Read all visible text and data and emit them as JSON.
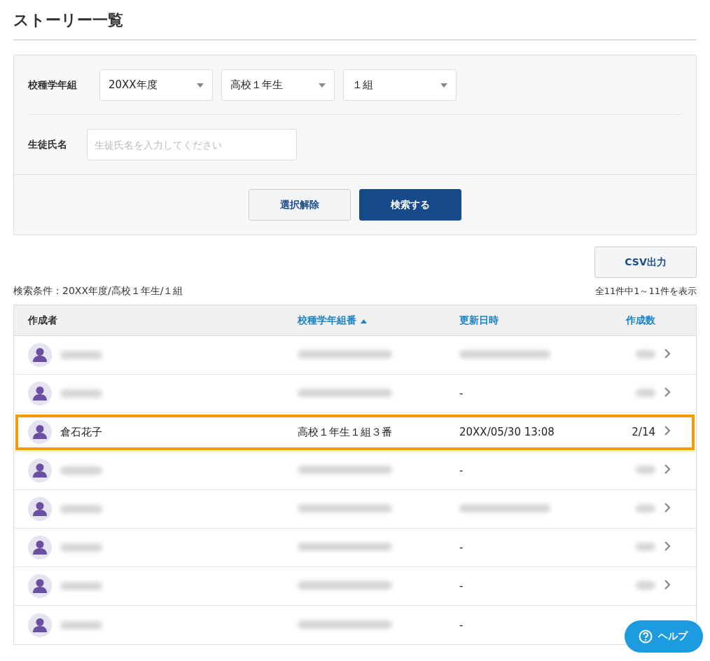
{
  "title": "ストーリー一覧",
  "filter": {
    "grade_label": "校種学年組",
    "selects": [
      {
        "value": "20XX年度"
      },
      {
        "value": "高校１年生"
      },
      {
        "value": "１組"
      }
    ],
    "name_label": "生徒氏名",
    "name_placeholder": "生徒氏名を入力してください",
    "buttons": [
      {
        "label": "選択解除",
        "kind": "secondary"
      },
      {
        "label": "検索する",
        "kind": "primary"
      }
    ]
  },
  "csv_button": "CSV出力",
  "condition": "検索条件：20XX年度/高校１年生/１組",
  "result_count": "全11件中1～11件を表示",
  "table": {
    "columns": [
      {
        "label": "作成者",
        "sortable": false,
        "sorted": false
      },
      {
        "label": "校種学年組番",
        "sortable": true,
        "sorted": true
      },
      {
        "label": "更新日時",
        "sortable": true,
        "sorted": false
      },
      {
        "label": "作成数",
        "sortable": true,
        "sorted": false
      }
    ],
    "rows": [
      {
        "highlighted": false
      },
      {
        "highlighted": false,
        "updated": "-"
      },
      {
        "highlighted": true,
        "name": "倉石花子",
        "class": "高校１年生１組３番",
        "updated": "20XX/05/30 13:08",
        "count": "2/14"
      },
      {
        "highlighted": false,
        "updated": "-"
      },
      {
        "highlighted": false
      },
      {
        "highlighted": false,
        "updated": "-"
      },
      {
        "highlighted": false,
        "updated": "-"
      },
      {
        "highlighted": false,
        "updated": "-",
        "chevron_hidden": true
      }
    ]
  },
  "help_button": "ヘルプ"
}
